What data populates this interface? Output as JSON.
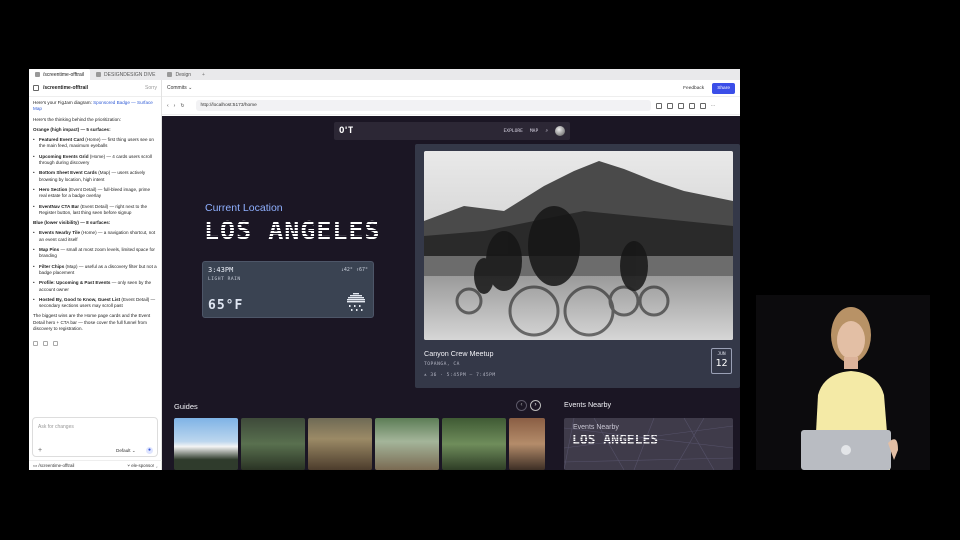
{
  "browser_tabs": [
    "/screentime-offtrail",
    "DESIGNDESIGN DIVE",
    "Design"
  ],
  "chat": {
    "title": "/screentime-offtrail",
    "header_right": "Sorry",
    "intro_prefix": "Here's your FigJam diagram: ",
    "intro_link": "Sponsored Badge — Surface Map",
    "thinking": "Here's the thinking behind the prioritization:",
    "orange_heading": "Orange (high impact) — 5 surfaces:",
    "orange_items": [
      {
        "b": "Featured Event Card",
        "t": " (Home) — first thing users see on the main feed, maximum eyeballs"
      },
      {
        "b": "Upcoming Events Grid",
        "t": " (Home) — 4 cards users scroll through during discovery"
      },
      {
        "b": "Bottom Sheet Event Cards",
        "t": " (Map) — users actively browsing by location, high intent"
      },
      {
        "b": "Hero Section",
        "t": " (Event Detail) — full-bleed image, prime real estate for a badge overlay"
      },
      {
        "b": "EventNav CTA Bar",
        "t": " (Event Detail) — right next to the Register button, last thing seen before signup"
      }
    ],
    "blue_heading": "Blue (lower visibility) — 8 surfaces:",
    "blue_items": [
      {
        "b": "Events Nearby Tile",
        "t": " (Home) — a navigation shortcut, not an event card itself"
      },
      {
        "b": "Map Pins",
        "t": " — small at most zoom levels, limited space for branding"
      },
      {
        "b": "Filter Chips",
        "t": " (Map) — useful as a discovery filter but not a badge placement"
      },
      {
        "b": "Profile: Upcoming & Past Events",
        "t": " — only seen by the account owner"
      },
      {
        "b": "Hosted By, Good to Know, Guest List",
        "t": " (Event Detail) — secondary sections users may scroll past"
      }
    ],
    "summary": "The biggest wins are the Home page cards and the Event Detail hero + CTA bar — those cover the full funnel from discovery to registration.",
    "composer_placeholder": "Ask for changes",
    "composer_model": "Default",
    "footer_left": "/screentime-offtrail",
    "footer_right": "ele-sponsor"
  },
  "toolbar": {
    "commits": "Commits",
    "feedback": "Feedback",
    "share": "Share",
    "url": "http://localhost:5173/home"
  },
  "app": {
    "logo": "O'T",
    "nav": [
      "EXPLORE",
      "MAP"
    ],
    "current_location_label": "Current Location",
    "city": "LOS ANGELES",
    "weather": {
      "time": "3:43PM",
      "condition": "LIGHT RAIN",
      "hilo": "↓42° ↑67°",
      "temp": "65°F"
    },
    "featured_event": {
      "title": "Canyon Crew Meetup",
      "location": "TOPANGA, CA",
      "meta": "⩚ 36 · 5:45PM – 7:45PM",
      "month": "JUN",
      "day": "12"
    },
    "guides_heading": "Guides",
    "nearby_heading": "Events Nearby",
    "nearby_label": "Events Nearby",
    "nearby_city": "LOS ANGELES"
  }
}
